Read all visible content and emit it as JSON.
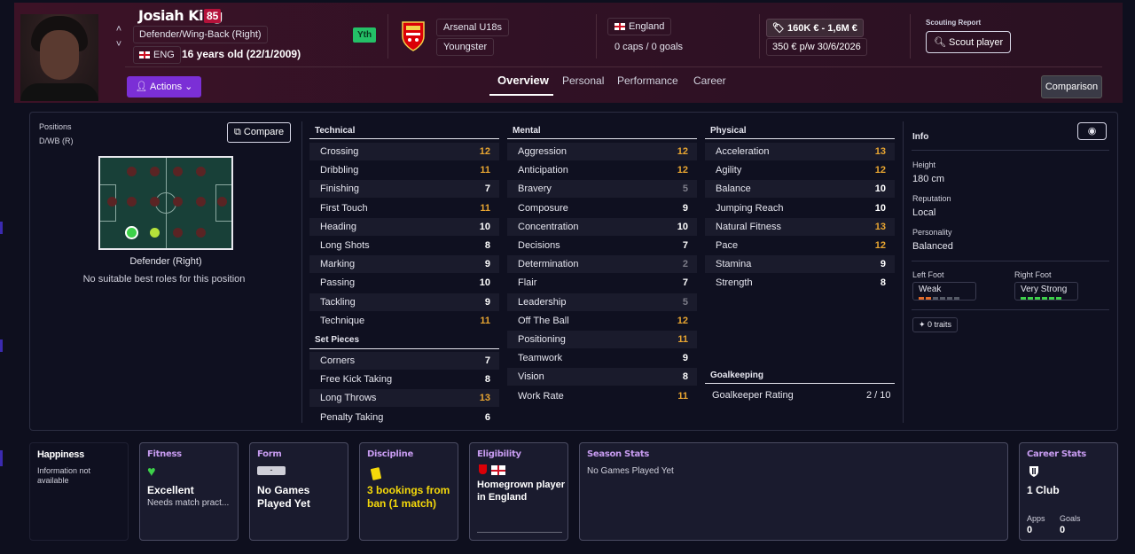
{
  "header": {
    "name": "Josiah King",
    "ca": "85",
    "position": "Defender/Wing-Back (Right)",
    "nationality": "ENG",
    "age": "16 years old (22/1/2009)",
    "youth_badge": "Yth",
    "club": "Arsenal U18s",
    "status": "Youngster",
    "country": "England",
    "caps": "0 caps / 0 goals",
    "value": "160K € - 1,6M €",
    "wage": "350 € p/w",
    "contract": "30/6/2026",
    "scout_label": "Scouting Report",
    "scout_button": "Scout player",
    "actions": "Actions",
    "comparison": "Comparison"
  },
  "tabs": [
    "Overview",
    "Personal",
    "Performance",
    "Career"
  ],
  "positions": {
    "label": "Positions",
    "value": "D/WB (R)",
    "compare": "Compare",
    "role": "Defender (Right)",
    "note": "No suitable best roles for this position"
  },
  "technical": {
    "title": "Technical",
    "rows": [
      {
        "name": "Crossing",
        "value": "12"
      },
      {
        "name": "Dribbling",
        "value": "11"
      },
      {
        "name": "Finishing",
        "value": "7"
      },
      {
        "name": "First Touch",
        "value": "11"
      },
      {
        "name": "Heading",
        "value": "10"
      },
      {
        "name": "Long Shots",
        "value": "8"
      },
      {
        "name": "Marking",
        "value": "9"
      },
      {
        "name": "Passing",
        "value": "10"
      },
      {
        "name": "Tackling",
        "value": "9"
      },
      {
        "name": "Technique",
        "value": "11"
      }
    ]
  },
  "set_pieces": {
    "title": "Set Pieces",
    "rows": [
      {
        "name": "Corners",
        "value": "7"
      },
      {
        "name": "Free Kick Taking",
        "value": "8"
      },
      {
        "name": "Long Throws",
        "value": "13"
      },
      {
        "name": "Penalty Taking",
        "value": "6"
      }
    ]
  },
  "mental": {
    "title": "Mental",
    "rows": [
      {
        "name": "Aggression",
        "value": "12"
      },
      {
        "name": "Anticipation",
        "value": "12"
      },
      {
        "name": "Bravery",
        "value": "5"
      },
      {
        "name": "Composure",
        "value": "9"
      },
      {
        "name": "Concentration",
        "value": "10"
      },
      {
        "name": "Decisions",
        "value": "7"
      },
      {
        "name": "Determination",
        "value": "2"
      },
      {
        "name": "Flair",
        "value": "7"
      },
      {
        "name": "Leadership",
        "value": "5"
      },
      {
        "name": "Off The Ball",
        "value": "12"
      },
      {
        "name": "Positioning",
        "value": "11"
      },
      {
        "name": "Teamwork",
        "value": "9"
      },
      {
        "name": "Vision",
        "value": "8"
      },
      {
        "name": "Work Rate",
        "value": "11"
      }
    ]
  },
  "physical": {
    "title": "Physical",
    "rows": [
      {
        "name": "Acceleration",
        "value": "13"
      },
      {
        "name": "Agility",
        "value": "12"
      },
      {
        "name": "Balance",
        "value": "10"
      },
      {
        "name": "Jumping Reach",
        "value": "10"
      },
      {
        "name": "Natural Fitness",
        "value": "13"
      },
      {
        "name": "Pace",
        "value": "12"
      },
      {
        "name": "Stamina",
        "value": "9"
      },
      {
        "name": "Strength",
        "value": "8"
      }
    ]
  },
  "goalkeeping": {
    "title": "Goalkeeping",
    "label": "Goalkeeper Rating",
    "value": "2 / 10"
  },
  "info": {
    "title": "Info",
    "height_label": "Height",
    "height": "180 cm",
    "reputation_label": "Reputation",
    "reputation": "Local",
    "personality_label": "Personality",
    "personality": "Balanced",
    "left_foot_label": "Left Foot",
    "left_foot": "Weak",
    "right_foot_label": "Right Foot",
    "right_foot": "Very Strong",
    "traits": "0 traits"
  },
  "cards": {
    "happiness": {
      "title": "Happiness",
      "text": "Information not available"
    },
    "fitness": {
      "title": "Fitness",
      "value": "Excellent",
      "sub": "Needs match pract..."
    },
    "form": {
      "title": "Form",
      "badge": "-",
      "value": "No Games Played Yet"
    },
    "discipline": {
      "title": "Discipline",
      "value": "3 bookings from ban (1 match)"
    },
    "eligibility": {
      "title": "Eligibility",
      "value": "Homegrown player in England"
    },
    "season": {
      "title": "Season Stats",
      "text": "No Games Played Yet"
    },
    "career": {
      "title": "Career Stats",
      "value": "1 Club",
      "apps_label": "Apps",
      "apps": "0",
      "goals_label": "Goals",
      "goals": "0"
    }
  },
  "colors": {
    "accent": "#7b2fd6",
    "highlight": "#e8a531",
    "header": "#3c1226"
  }
}
